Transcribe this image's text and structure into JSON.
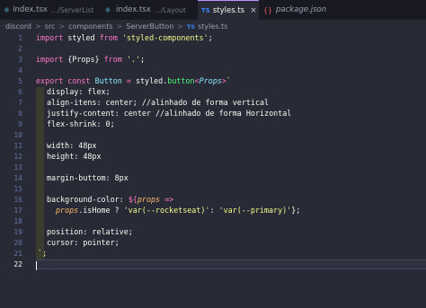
{
  "tabs": [
    {
      "icon": "react-icon",
      "label": "index.tsx",
      "path": ".../ServerList",
      "active": false
    },
    {
      "icon": "react-icon",
      "label": "index.tsx",
      "path": ".../Layout",
      "active": false
    },
    {
      "icon": "typescript-icon",
      "label": "styles.ts",
      "path": "",
      "active": true,
      "close": "×"
    },
    {
      "icon": "json-icon",
      "label": "package.json",
      "path": "",
      "active": false
    }
  ],
  "tab_icon_text": {
    "ts": "TS",
    "json": "{}",
    "react": "⚛"
  },
  "breadcrumb": {
    "items": [
      "discord",
      "src",
      "components",
      "ServerButton"
    ],
    "file_badge": "TS",
    "file": "styles.ts",
    "separator": ">"
  },
  "line_numbers": [
    "1",
    "2",
    "3",
    "4",
    "5",
    "6",
    "7",
    "8",
    "9",
    "10",
    "11",
    "12",
    "13",
    "14",
    "15",
    "16",
    "17",
    "18",
    "19",
    "20",
    "21",
    "22"
  ],
  "code": {
    "l1": {
      "a": "import",
      "b": " styled ",
      "c": "from",
      "d": " 'styled-components'",
      "e": ";"
    },
    "l3": {
      "a": "import",
      "b": " {Props} ",
      "c": "from",
      "d": " '.'",
      "e": ";"
    },
    "l5": {
      "a": "export",
      "b": " const ",
      "c": "Button",
      "d": " = ",
      "e": "styled",
      "f": ".",
      "g": "button",
      "h": "<",
      "i": "Props",
      "j": ">",
      "k": "`"
    },
    "l6": "display: flex;",
    "l7": "align-itens: center; //alinhado de forma vertical",
    "l8": "justify-content: center //alinhado de forma Horizontal",
    "l9": "flex-shrink: 0;",
    "l11": "width: 48px",
    "l12": "height: 48px",
    "l14": "margin-buttom: 8px",
    "l16": {
      "a": "background-color: ",
      "b": "${",
      "c": "props",
      "d": " =>"
    },
    "l17": {
      "a": "props",
      "b": ".isHome ? ",
      "c": "'var(--rocketseat)'",
      "d": ": ",
      "e": "'var(--primary)'",
      "f": "};"
    },
    "l19": "position: relative;",
    "l20": "cursor: pointer;",
    "l21": "`;"
  }
}
